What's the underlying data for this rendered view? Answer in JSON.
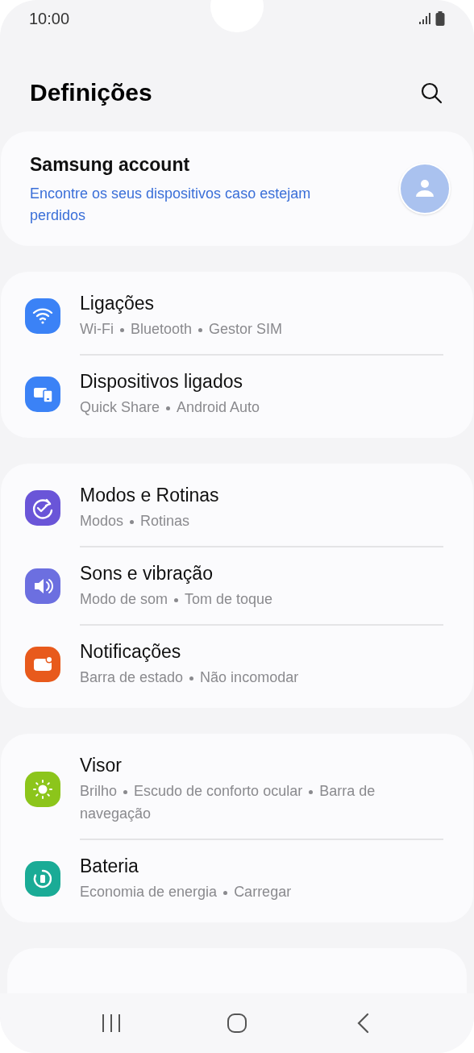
{
  "status_bar": {
    "time": "10:00"
  },
  "header": {
    "title": "Definições"
  },
  "account": {
    "title": "Samsung account",
    "subtitle": "Encontre os seus dispositivos caso estejam perdidos"
  },
  "groups": [
    {
      "items": [
        {
          "kind": "wifi",
          "color": "#3b82f6",
          "title": "Ligações",
          "details": [
            "Wi-Fi",
            "Bluetooth",
            "Gestor SIM"
          ]
        },
        {
          "kind": "devices",
          "color": "#3b82f6",
          "title": "Dispositivos ligados",
          "details": [
            "Quick Share",
            "Android Auto"
          ]
        }
      ]
    },
    {
      "items": [
        {
          "kind": "routines",
          "color": "#6a55d8",
          "title": "Modos e Rotinas",
          "details": [
            "Modos",
            "Rotinas"
          ]
        },
        {
          "kind": "sound",
          "color": "#6c6fe0",
          "title": "Sons e vibração",
          "details": [
            "Modo de som",
            "Tom de toque"
          ]
        },
        {
          "kind": "notifications",
          "color": "#e85a1c",
          "title": "Notificações",
          "details": [
            "Barra de estado",
            "Não incomodar"
          ]
        }
      ]
    },
    {
      "items": [
        {
          "kind": "display",
          "color": "#8cc51b",
          "title": "Visor",
          "details": [
            "Brilho",
            "Escudo de conforto ocular",
            "Barra de navegação"
          ]
        },
        {
          "kind": "battery",
          "color": "#1aab96",
          "title": "Bateria",
          "details": [
            "Economia de energia",
            "Carregar"
          ]
        }
      ]
    }
  ]
}
